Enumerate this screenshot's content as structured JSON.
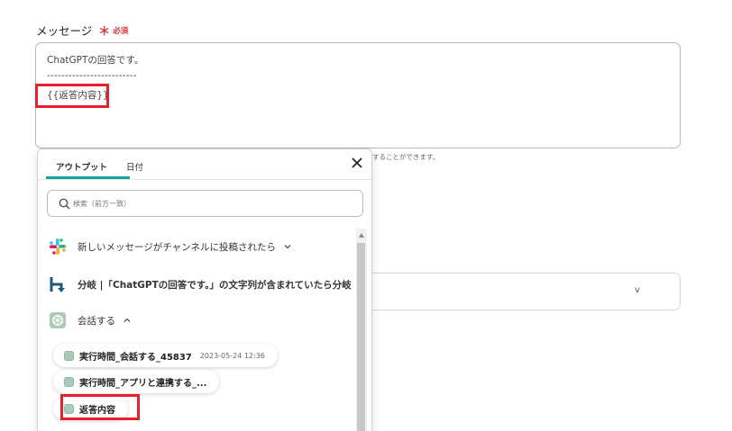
{
  "field": {
    "label": "メッセージ",
    "required_mark": "＊",
    "required_text": "必須"
  },
  "message": {
    "line1": "ChatGPTの回答です。",
    "line2": "-------------------------",
    "line3": "{{返答内容}}"
  },
  "helper_text": "することができます。",
  "background_select": {
    "chevron": "v"
  },
  "popup": {
    "tabs": [
      {
        "label": "アウトプット",
        "active": true
      },
      {
        "label": "日付",
        "active": false
      }
    ],
    "search_placeholder": "検索（前方一致）",
    "steps": [
      {
        "label": "新しいメッセージがチャンネルに投稿されたら",
        "icon": "slack-icon"
      },
      {
        "label": "分岐 |「ChatGPTの回答です。」の文字列が含まれていたら分岐",
        "icon": "branch-icon"
      },
      {
        "label": "会話する",
        "icon": "openai-icon"
      }
    ],
    "outputs": [
      {
        "label": "実行時間_会話する_45837",
        "time": "2023-05-24 12:36"
      },
      {
        "label": "実行時間_アプリと連携する_...",
        "time": ""
      },
      {
        "label": "返答内容",
        "time": ""
      }
    ]
  },
  "colors": {
    "accent": "#18a2a0",
    "highlight": "#e8202b",
    "required": "#e0323a",
    "branch": "#1f5a7a"
  }
}
